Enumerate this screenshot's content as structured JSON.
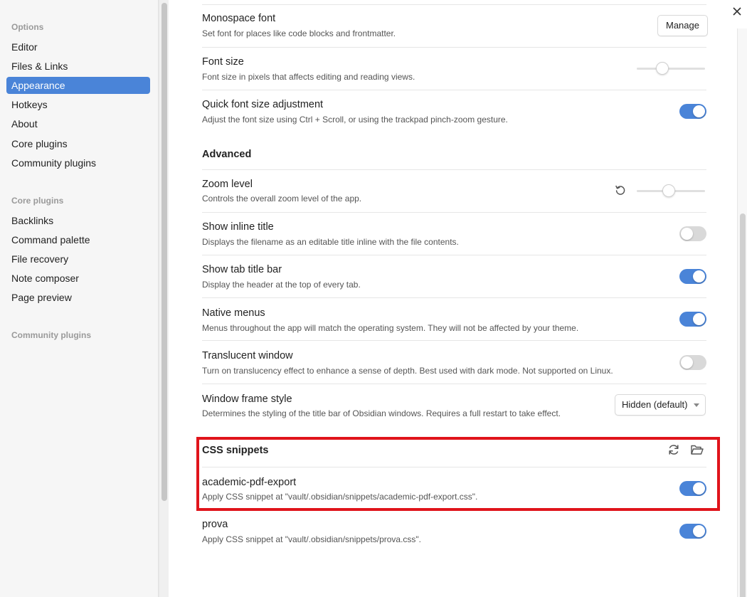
{
  "sidebar": {
    "options_heading": "Options",
    "options": [
      {
        "label": "Editor"
      },
      {
        "label": "Files & Links"
      },
      {
        "label": "Appearance",
        "active": true
      },
      {
        "label": "Hotkeys"
      },
      {
        "label": "About"
      },
      {
        "label": "Core plugins"
      },
      {
        "label": "Community plugins"
      }
    ],
    "core_heading": "Core plugins",
    "core_plugins": [
      {
        "label": "Backlinks"
      },
      {
        "label": "Command palette"
      },
      {
        "label": "File recovery"
      },
      {
        "label": "Note composer"
      },
      {
        "label": "Page preview"
      }
    ],
    "community_heading": "Community plugins"
  },
  "settings": {
    "monospace": {
      "name": "Monospace font",
      "desc": "Set font for places like code blocks and frontmatter.",
      "button": "Manage"
    },
    "font_size": {
      "name": "Font size",
      "desc": "Font size in pixels that affects editing and reading views.",
      "slider_fraction": 0.35
    },
    "quick_font": {
      "name": "Quick font size adjustment",
      "desc": "Adjust the font size using Ctrl + Scroll, or using the trackpad pinch-zoom gesture.",
      "enabled": true
    },
    "advanced_heading": "Advanced",
    "zoom": {
      "name": "Zoom level",
      "desc": "Controls the overall zoom level of the app.",
      "slider_fraction": 0.46
    },
    "inline_title": {
      "name": "Show inline title",
      "desc": "Displays the filename as an editable title inline with the file contents.",
      "enabled": false
    },
    "tab_title_bar": {
      "name": "Show tab title bar",
      "desc": "Display the header at the top of every tab.",
      "enabled": true
    },
    "native_menus": {
      "name": "Native menus",
      "desc": "Menus throughout the app will match the operating system. They will not be affected by your theme.",
      "enabled": true
    },
    "translucent": {
      "name": "Translucent window",
      "desc": "Turn on translucency effect to enhance a sense of depth. Best used with dark mode. Not supported on Linux.",
      "enabled": false
    },
    "frame_style": {
      "name": "Window frame style",
      "desc": "Determines the styling of the title bar of Obsidian windows. Requires a full restart to take effect.",
      "value": "Hidden (default)"
    },
    "snippets_heading": "CSS snippets",
    "snippets": [
      {
        "name": "academic-pdf-export",
        "desc": "Apply CSS snippet at \"vault/.obsidian/snippets/academic-pdf-export.css\".",
        "enabled": true
      },
      {
        "name": "prova",
        "desc": "Apply CSS snippet at \"vault/.obsidian/snippets/prova.css\".",
        "enabled": true
      }
    ]
  },
  "icons": {
    "close": "close-icon",
    "reset": "reset-icon",
    "reload": "reload-icon",
    "folder": "folder-open-icon"
  },
  "colors": {
    "accent": "#4a84d8",
    "highlight": "#e0141b"
  }
}
